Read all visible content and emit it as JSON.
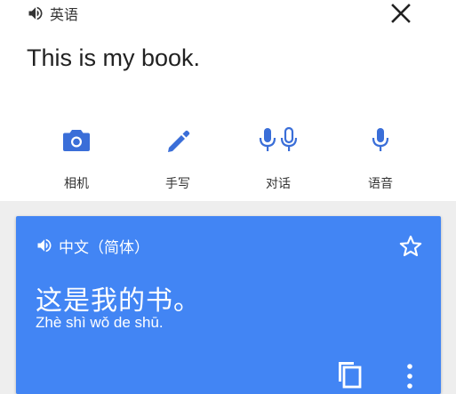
{
  "source": {
    "language_label": "英语",
    "text": "This is my book."
  },
  "input_tools": [
    {
      "label": "相机",
      "icon": "camera-icon"
    },
    {
      "label": "手写",
      "icon": "pen-icon"
    },
    {
      "label": "对话",
      "icon": "conversation-mic-icon"
    },
    {
      "label": "语音",
      "icon": "mic-icon"
    }
  ],
  "result": {
    "language_label": "中文（简体）",
    "text": "这是我的书。",
    "romanization": "Zhè shì wǒ de shū."
  },
  "colors": {
    "accent": "#4285f4",
    "icon_blue": "#3a6ed8",
    "panel_bg": "#ffffff",
    "page_bg": "#eeeeee"
  }
}
